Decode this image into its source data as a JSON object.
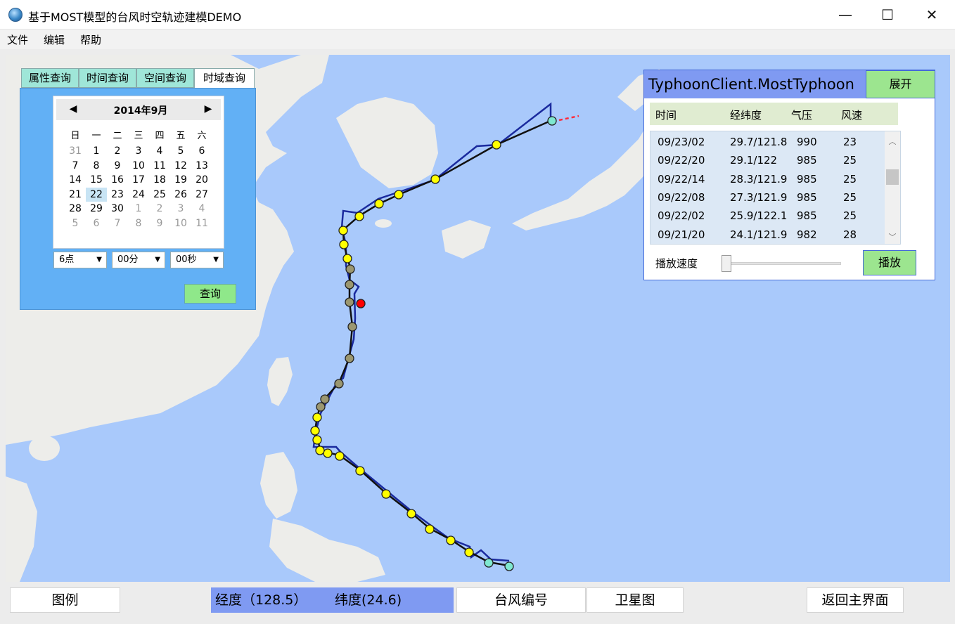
{
  "window": {
    "title": "基于MOST模型的台风时空轨迹建模DEMO",
    "minimize": "—",
    "maximize": "☐",
    "close": "✕"
  },
  "menu": [
    "文件",
    "编辑",
    "帮助"
  ],
  "query_panel": {
    "tabs": [
      "属性查询",
      "时间查询",
      "空间查询",
      "时域查询"
    ],
    "active_tab": "时域查询",
    "calendar": {
      "prev": "◀",
      "next": "▶",
      "month_label": "2014年9月",
      "weekdays": [
        "日",
        "一",
        "二",
        "三",
        "四",
        "五",
        "六"
      ],
      "weeks": [
        [
          "31",
          "1",
          "2",
          "3",
          "4",
          "5",
          "6"
        ],
        [
          "7",
          "8",
          "9",
          "10",
          "11",
          "12",
          "13"
        ],
        [
          "14",
          "15",
          "16",
          "17",
          "18",
          "19",
          "20"
        ],
        [
          "21",
          "22",
          "23",
          "24",
          "25",
          "26",
          "27"
        ],
        [
          "28",
          "29",
          "30",
          "1",
          "2",
          "3",
          "4"
        ],
        [
          "5",
          "6",
          "7",
          "8",
          "9",
          "10",
          "11"
        ]
      ],
      "selected_day": "22"
    },
    "hour": "6点",
    "minute": "00分",
    "second": "00秒",
    "query_button": "查询"
  },
  "info_panel": {
    "title": "TyphoonClient.MostTyphoon",
    "expand_button": "展开",
    "columns": [
      "时间",
      "经纬度",
      "气压",
      "风速"
    ],
    "rows": [
      [
        "09/23/02",
        "29.7/121.8",
        "990",
        "23"
      ],
      [
        "09/22/20",
        "29.1/122",
        "985",
        "25"
      ],
      [
        "09/22/14",
        "28.3/121.9",
        "985",
        "25"
      ],
      [
        "09/22/08",
        "27.3/121.9",
        "985",
        "25"
      ],
      [
        "09/22/02",
        "25.9/122.1",
        "985",
        "25"
      ],
      [
        "09/21/20",
        "24.1/121.9",
        "982",
        "28"
      ]
    ],
    "speed_label": "播放速度",
    "speed_value": 0,
    "play_button": "播放"
  },
  "bottom": {
    "legend_button": "图例",
    "longitude_text": "经度（128.5）",
    "latitude_text": "纬度(24.6)",
    "typhoon_id_button": "台风编号",
    "satellite_button": "卫星图",
    "back_button": "返回主界面"
  },
  "colors": {
    "map_sea": "#a9c9fb",
    "land": "#ededea",
    "track_point": "#ffff00",
    "observed_point": "#9b9770",
    "end_point": "#7fe8d0",
    "current_point": "#ff0000",
    "title_blue": "#7f9af2",
    "button_green": "#9ce58f",
    "tab_teal": "#9fe6d8",
    "query_panel_blue": "#62b0f5"
  }
}
